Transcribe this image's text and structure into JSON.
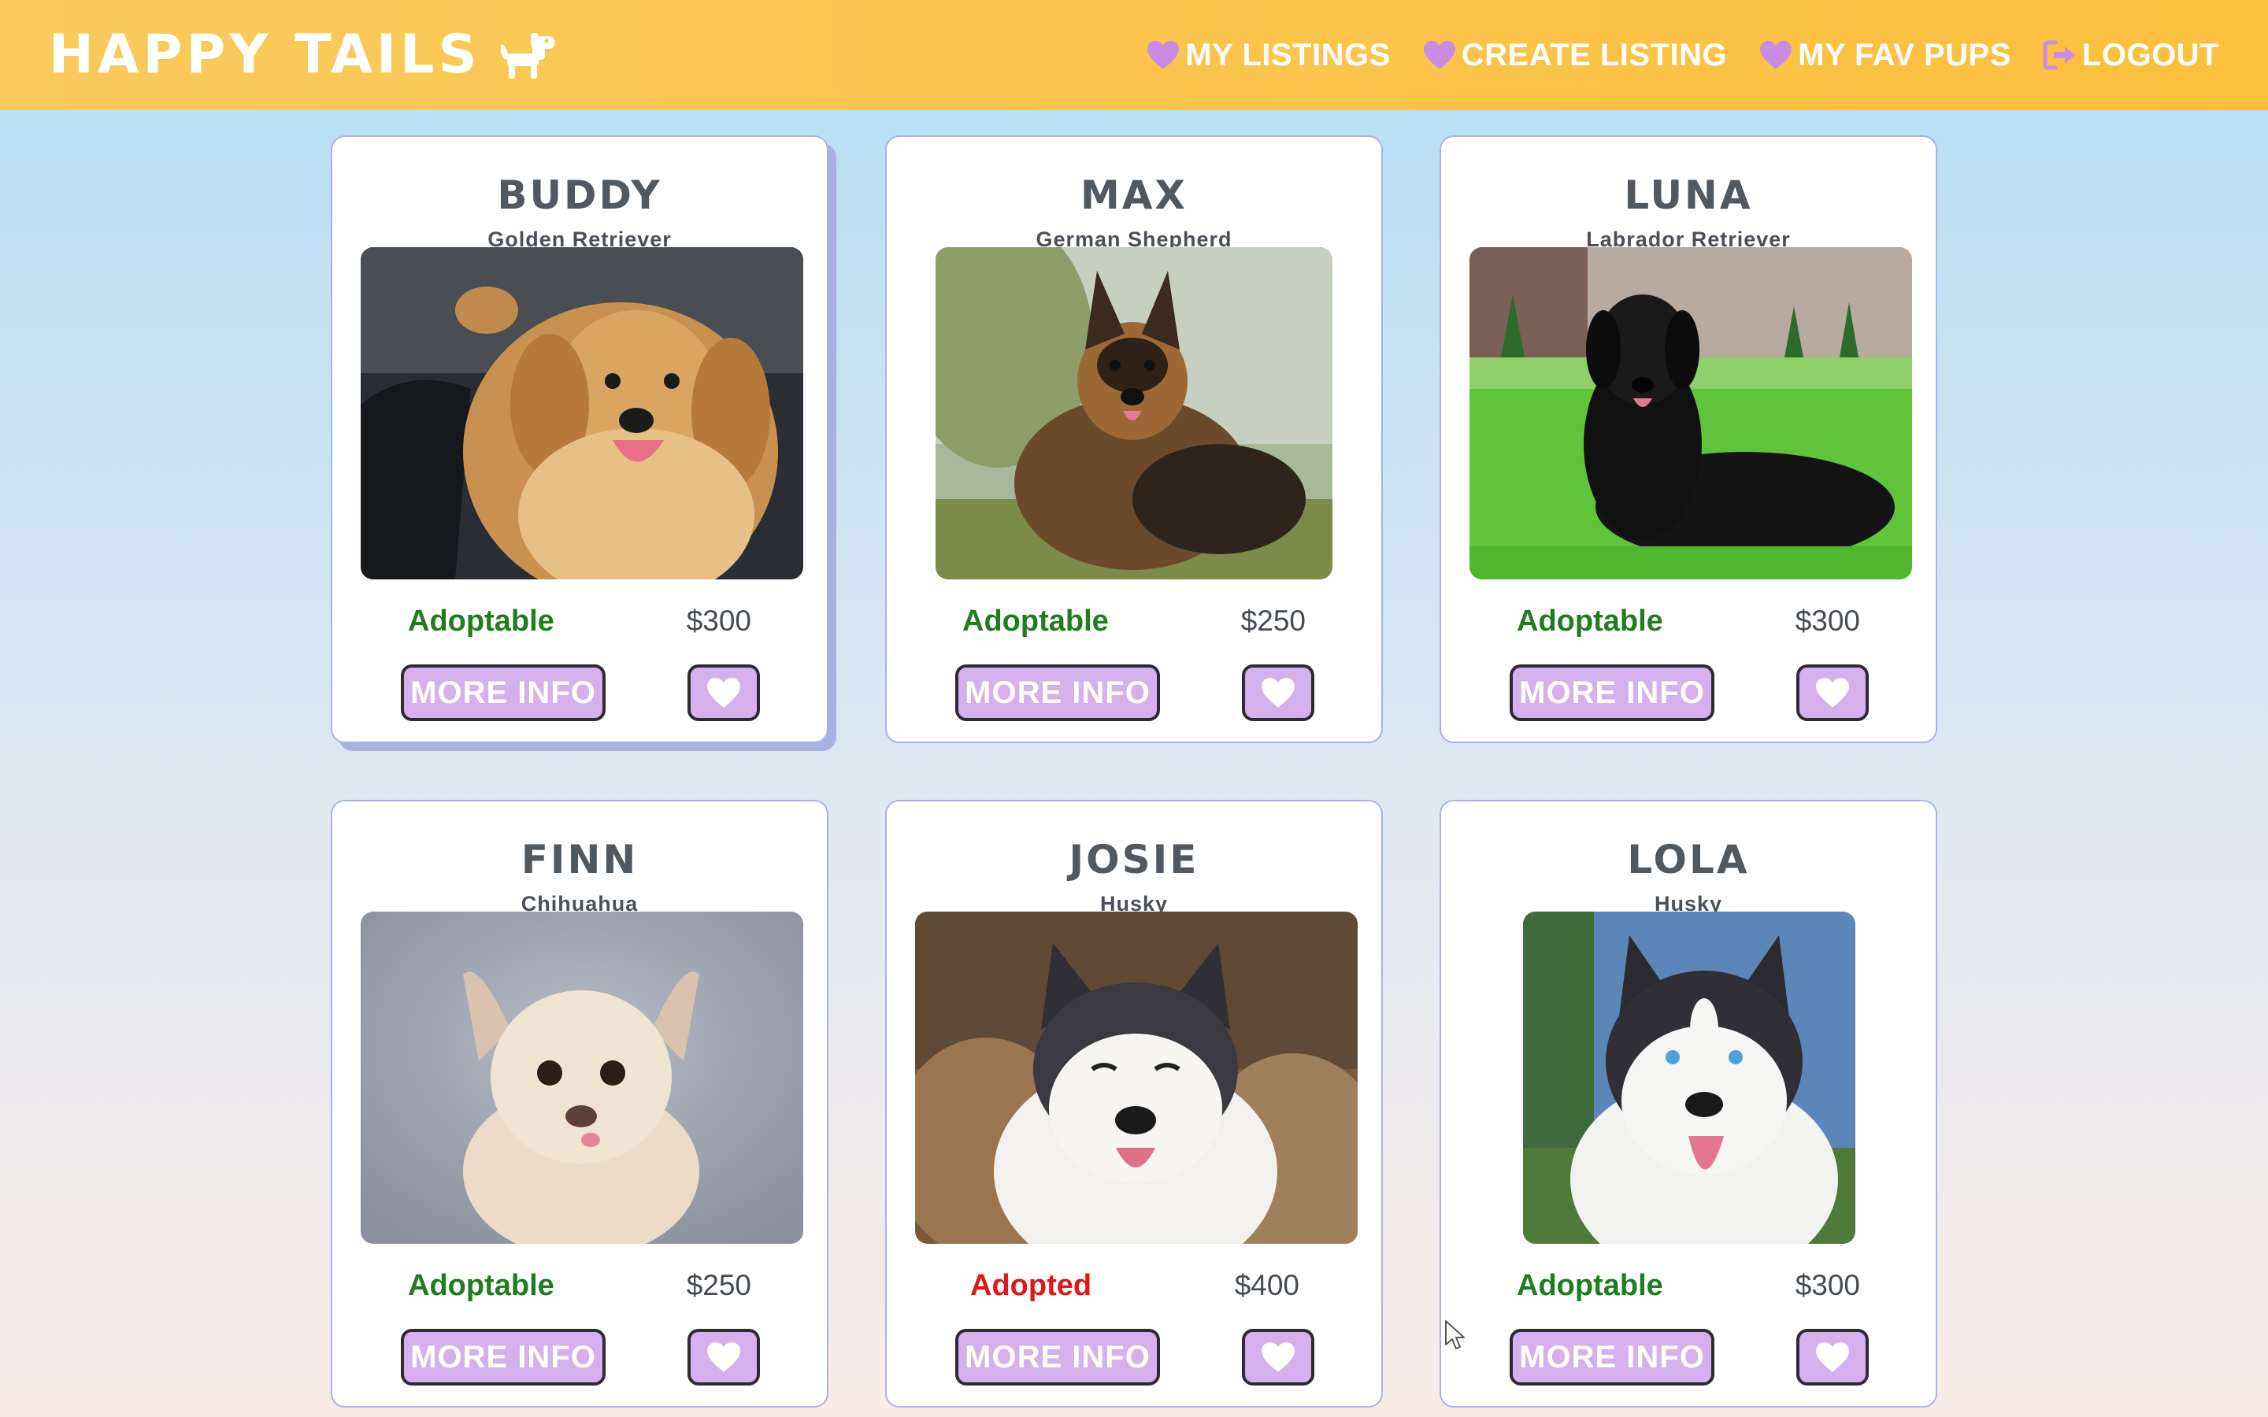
{
  "brand": {
    "title": "HAPPY TAILS",
    "logo_icon": "dog-icon"
  },
  "nav": [
    {
      "label": "MY LISTINGS",
      "icon": "heart-icon"
    },
    {
      "label": "CREATE LISTING",
      "icon": "heart-icon"
    },
    {
      "label": "MY FAV PUPS",
      "icon": "heart-icon"
    },
    {
      "label": "LOGOUT",
      "icon": "logout-icon"
    }
  ],
  "colors": {
    "header_gradient_start": "#f9cb5c",
    "header_gradient_end": "#fcbf3e",
    "nav_icon": "#c98be6",
    "button_bg": "#d4b0ec",
    "adoptable": "#1f7d1f",
    "adopted": "#e0161c"
  },
  "listings": [
    {
      "name": "BUDDY",
      "breed": "Golden Retriever",
      "status": "Adoptable",
      "price": "$300",
      "button": "MORE INFO",
      "photo": "golden-retriever-photo"
    },
    {
      "name": "MAX",
      "breed": "German Shepherd",
      "status": "Adoptable",
      "price": "$250",
      "button": "MORE INFO",
      "photo": "german-shepherd-photo"
    },
    {
      "name": "LUNA",
      "breed": "Labrador Retriever",
      "status": "Adoptable",
      "price": "$300",
      "button": "MORE INFO",
      "photo": "black-labrador-photo"
    },
    {
      "name": "FINN",
      "breed": "Chihuahua",
      "status": "Adoptable",
      "price": "$250",
      "button": "MORE INFO",
      "photo": "chihuahua-photo"
    },
    {
      "name": "JOSIE",
      "breed": "Husky",
      "status": "Adopted",
      "price": "$400",
      "button": "MORE INFO",
      "photo": "husky-photo"
    },
    {
      "name": "LOLA",
      "breed": "Husky",
      "status": "Adoptable",
      "price": "$300",
      "button": "MORE INFO",
      "photo": "husky-photo"
    }
  ]
}
